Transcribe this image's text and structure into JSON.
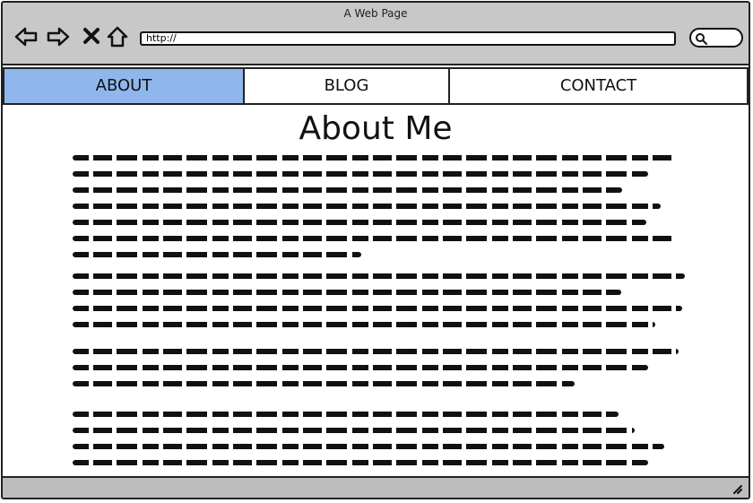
{
  "window": {
    "title": "A Web Page"
  },
  "browser": {
    "address_value": "http://"
  },
  "icons": {
    "back": "left-arrow-outline",
    "forward": "right-arrow-outline",
    "stop": "cross",
    "home": "house-outline",
    "search": "magnifier",
    "resize": "resize-grip"
  },
  "nav": {
    "tabs": [
      {
        "label": "ABOUT",
        "active": true
      },
      {
        "label": "BLOG",
        "active": false
      },
      {
        "label": "CONTACT",
        "active": false
      }
    ]
  },
  "main": {
    "title": "About Me"
  },
  "colors": {
    "frame": "#c8c8c8",
    "active_tab": "#8fb7ee",
    "ink": "#111111",
    "page": "#ffffff"
  }
}
